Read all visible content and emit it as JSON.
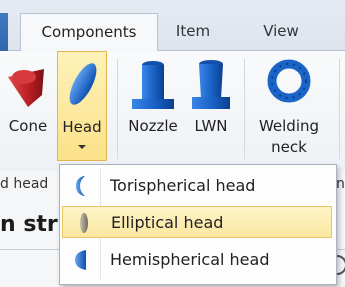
{
  "tabs": [
    {
      "label": "Components",
      "active": true
    },
    {
      "label": "Item"
    },
    {
      "label": "View"
    }
  ],
  "ribbon": {
    "buttons": [
      {
        "label": "Cone",
        "icon": "cone-icon"
      },
      {
        "label": "Head",
        "icon": "head-icon",
        "highlighted": true
      },
      {
        "label": "Nozzle",
        "icon": "nozzle-icon"
      },
      {
        "label": "LWN",
        "icon": "lwn-icon"
      },
      {
        "label_line1": "Welding",
        "label_line2": "neck",
        "icon": "welding-neck-flange-icon"
      }
    ],
    "group_label_left": "d head",
    "group_label_right": "n"
  },
  "content": {
    "strip_text": "n str"
  },
  "dropdown_menu": {
    "items": [
      {
        "label": "Torispherical head",
        "icon": "torispherical-head-icon"
      },
      {
        "label": "Elliptical head",
        "icon": "elliptical-head-icon",
        "selected": true
      },
      {
        "label": "Hemispherical head",
        "icon": "hemispherical-head-icon"
      }
    ]
  },
  "colors": {
    "accent_blue": "#1565c0",
    "hover_yellow": "#fbe189",
    "cone_red": "#c0282a"
  }
}
